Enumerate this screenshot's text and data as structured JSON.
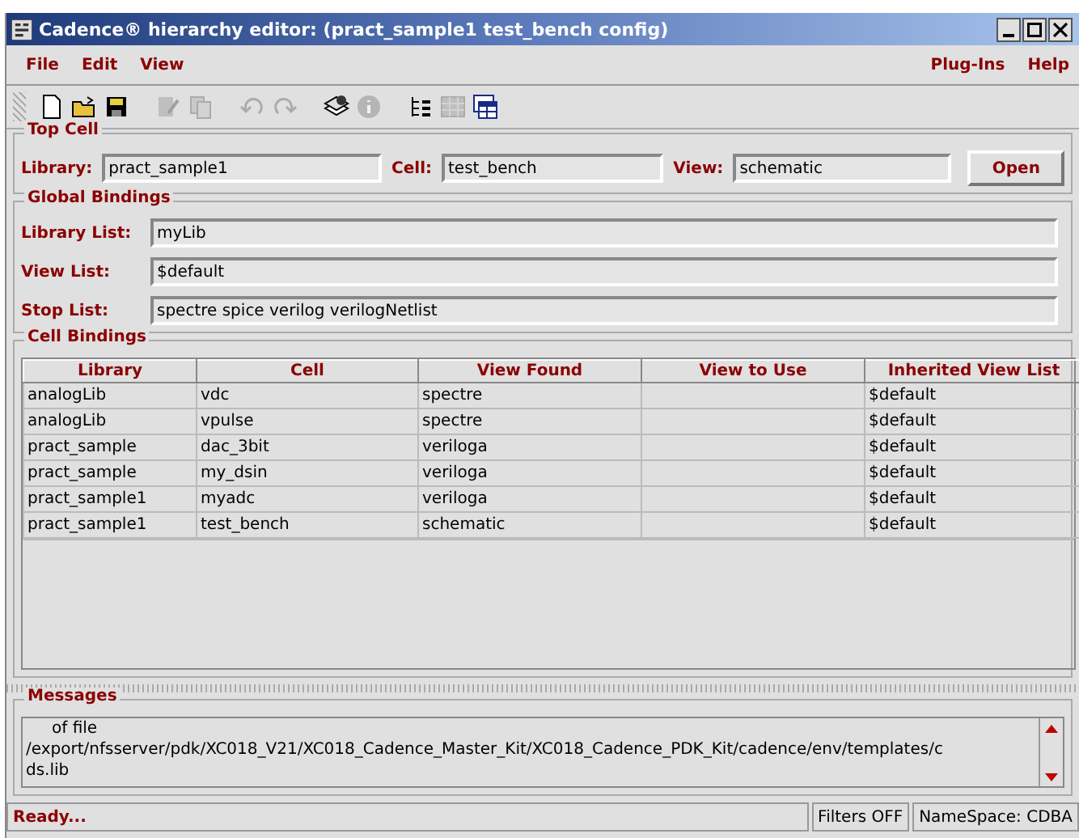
{
  "window": {
    "title": "Cadence® hierarchy editor: (pract_sample1 test_bench config)"
  },
  "menus": {
    "left": [
      "File",
      "Edit",
      "View"
    ],
    "right": [
      "Plug-Ins",
      "Help"
    ]
  },
  "toolbar": [
    {
      "kind": "new",
      "disabled": false
    },
    {
      "kind": "open",
      "disabled": false
    },
    {
      "kind": "save",
      "disabled": false
    },
    {
      "kind": "sep"
    },
    {
      "kind": "edit",
      "disabled": true
    },
    {
      "kind": "copy",
      "disabled": true
    },
    {
      "kind": "sep"
    },
    {
      "kind": "undo",
      "disabled": true
    },
    {
      "kind": "redo",
      "disabled": true
    },
    {
      "kind": "sep"
    },
    {
      "kind": "update",
      "disabled": false
    },
    {
      "kind": "info",
      "disabled": true
    },
    {
      "kind": "sep"
    },
    {
      "kind": "tree",
      "disabled": false
    },
    {
      "kind": "grid",
      "disabled": true
    },
    {
      "kind": "table",
      "disabled": false
    }
  ],
  "top_cell": {
    "title": "Top Cell",
    "fields": [
      {
        "label": "Library:",
        "value": "pract_sample1"
      },
      {
        "label": "Cell:",
        "value": "test_bench"
      },
      {
        "label": "View:",
        "value": "schematic"
      }
    ],
    "button": "Open"
  },
  "global_bindings": {
    "title": "Global Bindings",
    "fields": [
      {
        "label": "Library List:",
        "value": "myLib"
      },
      {
        "label": "View List:",
        "value": "$default"
      },
      {
        "label": "Stop List:",
        "value": "spectre spice verilog verilogNetlist"
      }
    ]
  },
  "cell_bindings": {
    "title": "Cell Bindings",
    "columns": [
      "Library",
      "Cell",
      "View Found",
      "View to Use",
      "Inherited View List"
    ],
    "rows": [
      [
        "analogLib",
        "vdc",
        "spectre",
        "",
        "$default"
      ],
      [
        "analogLib",
        "vpulse",
        "spectre",
        "",
        "$default"
      ],
      [
        "pract_sample",
        "dac_3bit",
        "veriloga",
        "",
        "$default"
      ],
      [
        "pract_sample",
        "my_dsin",
        "veriloga",
        "",
        "$default"
      ],
      [
        "pract_sample1",
        "myadc",
        "veriloga",
        "",
        "$default"
      ],
      [
        "pract_sample1",
        "test_bench",
        "schematic",
        "",
        "$default"
      ]
    ]
  },
  "messages": {
    "title": "Messages",
    "lines": [
      "of file",
      "/export/nfsserver/pdk/XC018_V21/XC018_Cadence_Master_Kit/XC018_Cadence_PDK_Kit/cadence/env/templates/c",
      "ds.lib"
    ]
  },
  "status_bar": {
    "message": "Ready...",
    "filters": "Filters OFF",
    "namespace": "NameSpace: CDBA"
  }
}
